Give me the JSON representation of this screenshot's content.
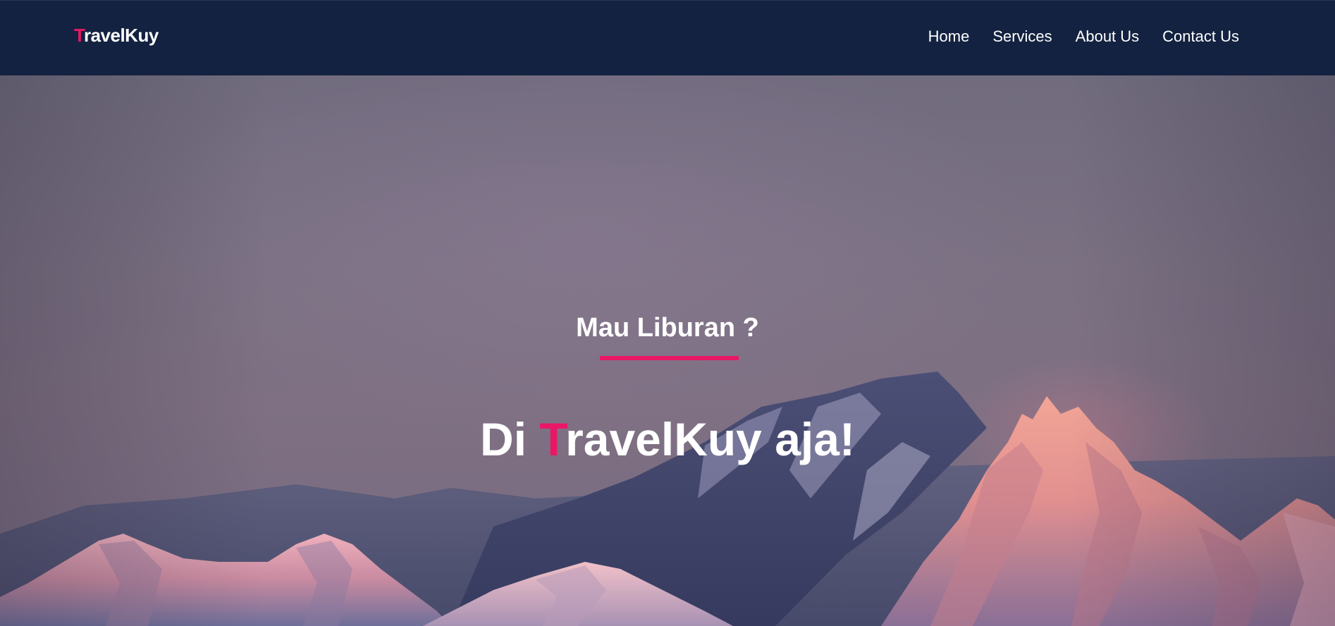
{
  "brand": {
    "initial": "T",
    "rest": "ravelKuy"
  },
  "nav": {
    "items": [
      {
        "label": "Home"
      },
      {
        "label": "Services"
      },
      {
        "label": "About Us"
      },
      {
        "label": "Contact Us"
      }
    ]
  },
  "hero": {
    "subtitle": "Mau Liburan ?",
    "title_prefix": "Di ",
    "title_accent": "T",
    "title_suffix": "ravelKuy aja!"
  },
  "colors": {
    "navbar_bg": "#132240",
    "accent": "#ea1766",
    "text": "#ffffff"
  }
}
